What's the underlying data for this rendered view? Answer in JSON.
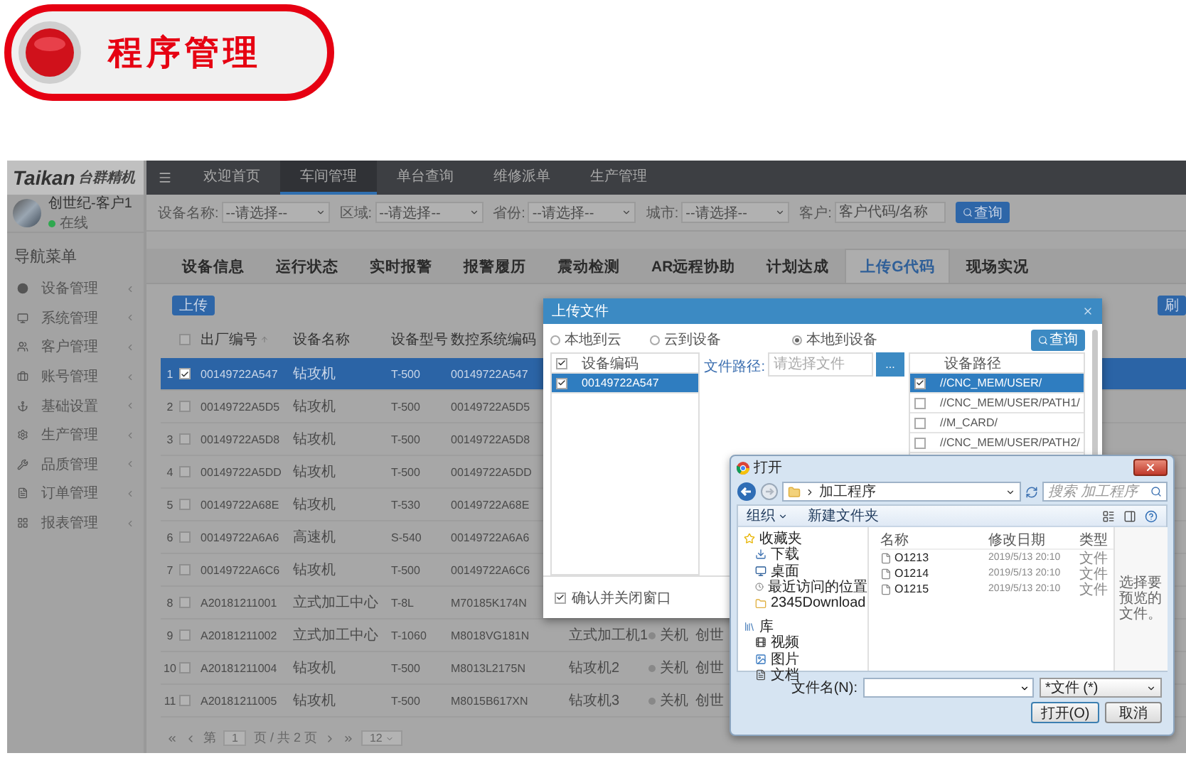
{
  "page_title": "程序管理",
  "sidebar": {
    "brand": "Taikan",
    "brand_cn": "台群精机",
    "user_name": "创世纪-客户1",
    "user_status": "在线",
    "online": true,
    "heading": "导航菜单",
    "items": [
      {
        "label": "设备管理"
      },
      {
        "label": "系统管理"
      },
      {
        "label": "客户管理"
      },
      {
        "label": "账号管理"
      },
      {
        "label": "基础设置"
      },
      {
        "label": "生产管理"
      },
      {
        "label": "品质管理"
      },
      {
        "label": "订单管理"
      },
      {
        "label": "报表管理"
      }
    ]
  },
  "top_nav": [
    {
      "label": "欢迎首页",
      "selected": false
    },
    {
      "label": "车间管理",
      "selected": true
    },
    {
      "label": "单台查询",
      "selected": false
    },
    {
      "label": "维修派单",
      "selected": false
    },
    {
      "label": "生产管理",
      "selected": false
    }
  ],
  "filters": [
    {
      "kind": "select",
      "label": "设备名称:",
      "value": "--请选择--"
    },
    {
      "kind": "select",
      "label": "区域:",
      "value": "--请选择--"
    },
    {
      "kind": "select",
      "label": "省份:",
      "value": "--请选择--"
    },
    {
      "kind": "select",
      "label": "城市:",
      "value": "--请选择--"
    },
    {
      "kind": "input",
      "label": "客户:",
      "placeholder": "客户代码/名称"
    }
  ],
  "search_button": "查询",
  "tabs": [
    {
      "label": "设备信息",
      "selected": false
    },
    {
      "label": "运行状态",
      "selected": false
    },
    {
      "label": "实时报警",
      "selected": false
    },
    {
      "label": "报警履历",
      "selected": false
    },
    {
      "label": "震动检测",
      "selected": false
    },
    {
      "label": "AR远程协助",
      "selected": false
    },
    {
      "label": "计划达成",
      "selected": false
    },
    {
      "label": "上传G代码",
      "selected": true
    },
    {
      "label": "现场实况",
      "selected": false
    }
  ],
  "upload_button": "上传",
  "refresh_button": "刷",
  "table": {
    "header_checked": false,
    "columns": [
      "出厂编号",
      "设备名称",
      "设备型号",
      "数控系统编码"
    ],
    "rows": [
      {
        "index": "1",
        "checked": true,
        "selected": true,
        "serial": "00149722A547",
        "name": "钻攻机",
        "model": "T-500",
        "cnc": "00149722A547"
      },
      {
        "index": "2",
        "checked": false,
        "selected": false,
        "serial": "00149722A5D5",
        "name": "钻攻机",
        "model": "T-500",
        "cnc": "00149722A5D5"
      },
      {
        "index": "3",
        "checked": false,
        "selected": false,
        "serial": "00149722A5D8",
        "name": "钻攻机",
        "model": "T-500",
        "cnc": "00149722A5D8"
      },
      {
        "index": "4",
        "checked": false,
        "selected": false,
        "serial": "00149722A5DD",
        "name": "钻攻机",
        "model": "T-500",
        "cnc": "00149722A5DD"
      },
      {
        "index": "5",
        "checked": false,
        "selected": false,
        "serial": "00149722A68E",
        "name": "钻攻机",
        "model": "T-530",
        "cnc": "00149722A68E"
      },
      {
        "index": "6",
        "checked": false,
        "selected": false,
        "serial": "00149722A6A6",
        "name": "高速机",
        "model": "S-540",
        "cnc": "00149722A6A6"
      },
      {
        "index": "7",
        "checked": false,
        "selected": false,
        "serial": "00149722A6C6",
        "name": "钻攻机",
        "model": "T-500",
        "cnc": "00149722A6C6"
      },
      {
        "index": "8",
        "checked": false,
        "selected": false,
        "serial": "A20181211001",
        "name": "立式加工中心",
        "model": "T-8L",
        "cnc": "M70185K174N"
      },
      {
        "index": "9",
        "checked": false,
        "selected": false,
        "serial": "A20181211002",
        "name": "立式加工中心",
        "model": "T-1060",
        "cnc": "M8018VG181N",
        "alias": "立式加工机1",
        "status": "关机",
        "running": false,
        "customer": "创世"
      },
      {
        "index": "10",
        "checked": false,
        "selected": false,
        "serial": "A20181211004",
        "name": "钻攻机",
        "model": "T-500",
        "cnc": "M8013L2175N",
        "alias": "钻攻机2",
        "status": "关机",
        "running": false,
        "customer": "创世"
      },
      {
        "index": "11",
        "checked": false,
        "selected": false,
        "serial": "A20181211005",
        "name": "钻攻机",
        "model": "T-500",
        "cnc": "M8015B617XN",
        "alias": "钻攻机3",
        "status": "关机",
        "running": false,
        "customer": "创世"
      }
    ]
  },
  "pagination": {
    "before": "第",
    "page": "1",
    "after": "页 / 共 2 页",
    "page_size": "12"
  },
  "upload_dialog": {
    "title": "上传文件",
    "sources": [
      {
        "label": "本地到云",
        "selected": false
      },
      {
        "label": "云到设备",
        "selected": false
      },
      {
        "label": "本地到设备",
        "selected": true
      }
    ],
    "query_button": "查询",
    "device_header": "设备编码",
    "device_header_checked": true,
    "devices": [
      {
        "code": "00149722A547",
        "checked": true,
        "selected": true
      }
    ],
    "path_label": "文件路径:",
    "path_placeholder": "请选择文件",
    "browse_button": "...",
    "paths_header": "设备路径",
    "paths": [
      {
        "path": "//CNC_MEM/USER/",
        "checked": true,
        "selected": true
      },
      {
        "path": "//CNC_MEM/USER/PATH1/",
        "checked": false,
        "selected": false
      },
      {
        "path": "//M_CARD/",
        "checked": false,
        "selected": false
      },
      {
        "path": "//CNC_MEM/USER/PATH2/",
        "checked": false,
        "selected": false
      }
    ],
    "confirm_label": "确认并关闭窗口",
    "confirm_checked": true
  },
  "file_dialog": {
    "title": "打开",
    "location": "加工程序",
    "search_placeholder": "搜索 加工程序",
    "organize": "组织",
    "new_folder": "新建文件夹",
    "nav": [
      {
        "kind": "group",
        "label": "收藏夹"
      },
      {
        "kind": "item",
        "label": "下载"
      },
      {
        "kind": "item",
        "label": "桌面"
      },
      {
        "kind": "item",
        "label": "最近访问的位置"
      },
      {
        "kind": "item",
        "label": "2345Download"
      },
      {
        "kind": "group",
        "label": "库"
      },
      {
        "kind": "item",
        "label": "视频"
      },
      {
        "kind": "item",
        "label": "图片"
      },
      {
        "kind": "item",
        "label": "文档"
      }
    ],
    "columns": [
      "名称",
      "修改日期",
      "类型"
    ],
    "files": [
      {
        "name": "O1213",
        "modified": "2019/5/13 20:10",
        "type": "文件"
      },
      {
        "name": "O1214",
        "modified": "2019/5/13 20:10",
        "type": "文件"
      },
      {
        "name": "O1215",
        "modified": "2019/5/13 20:10",
        "type": "文件"
      }
    ],
    "preview": "选择要预览的文件。",
    "filename_label": "文件名(N):",
    "filter": "*文件 (*)",
    "open_button": "打开(O)",
    "cancel_button": "取消"
  }
}
